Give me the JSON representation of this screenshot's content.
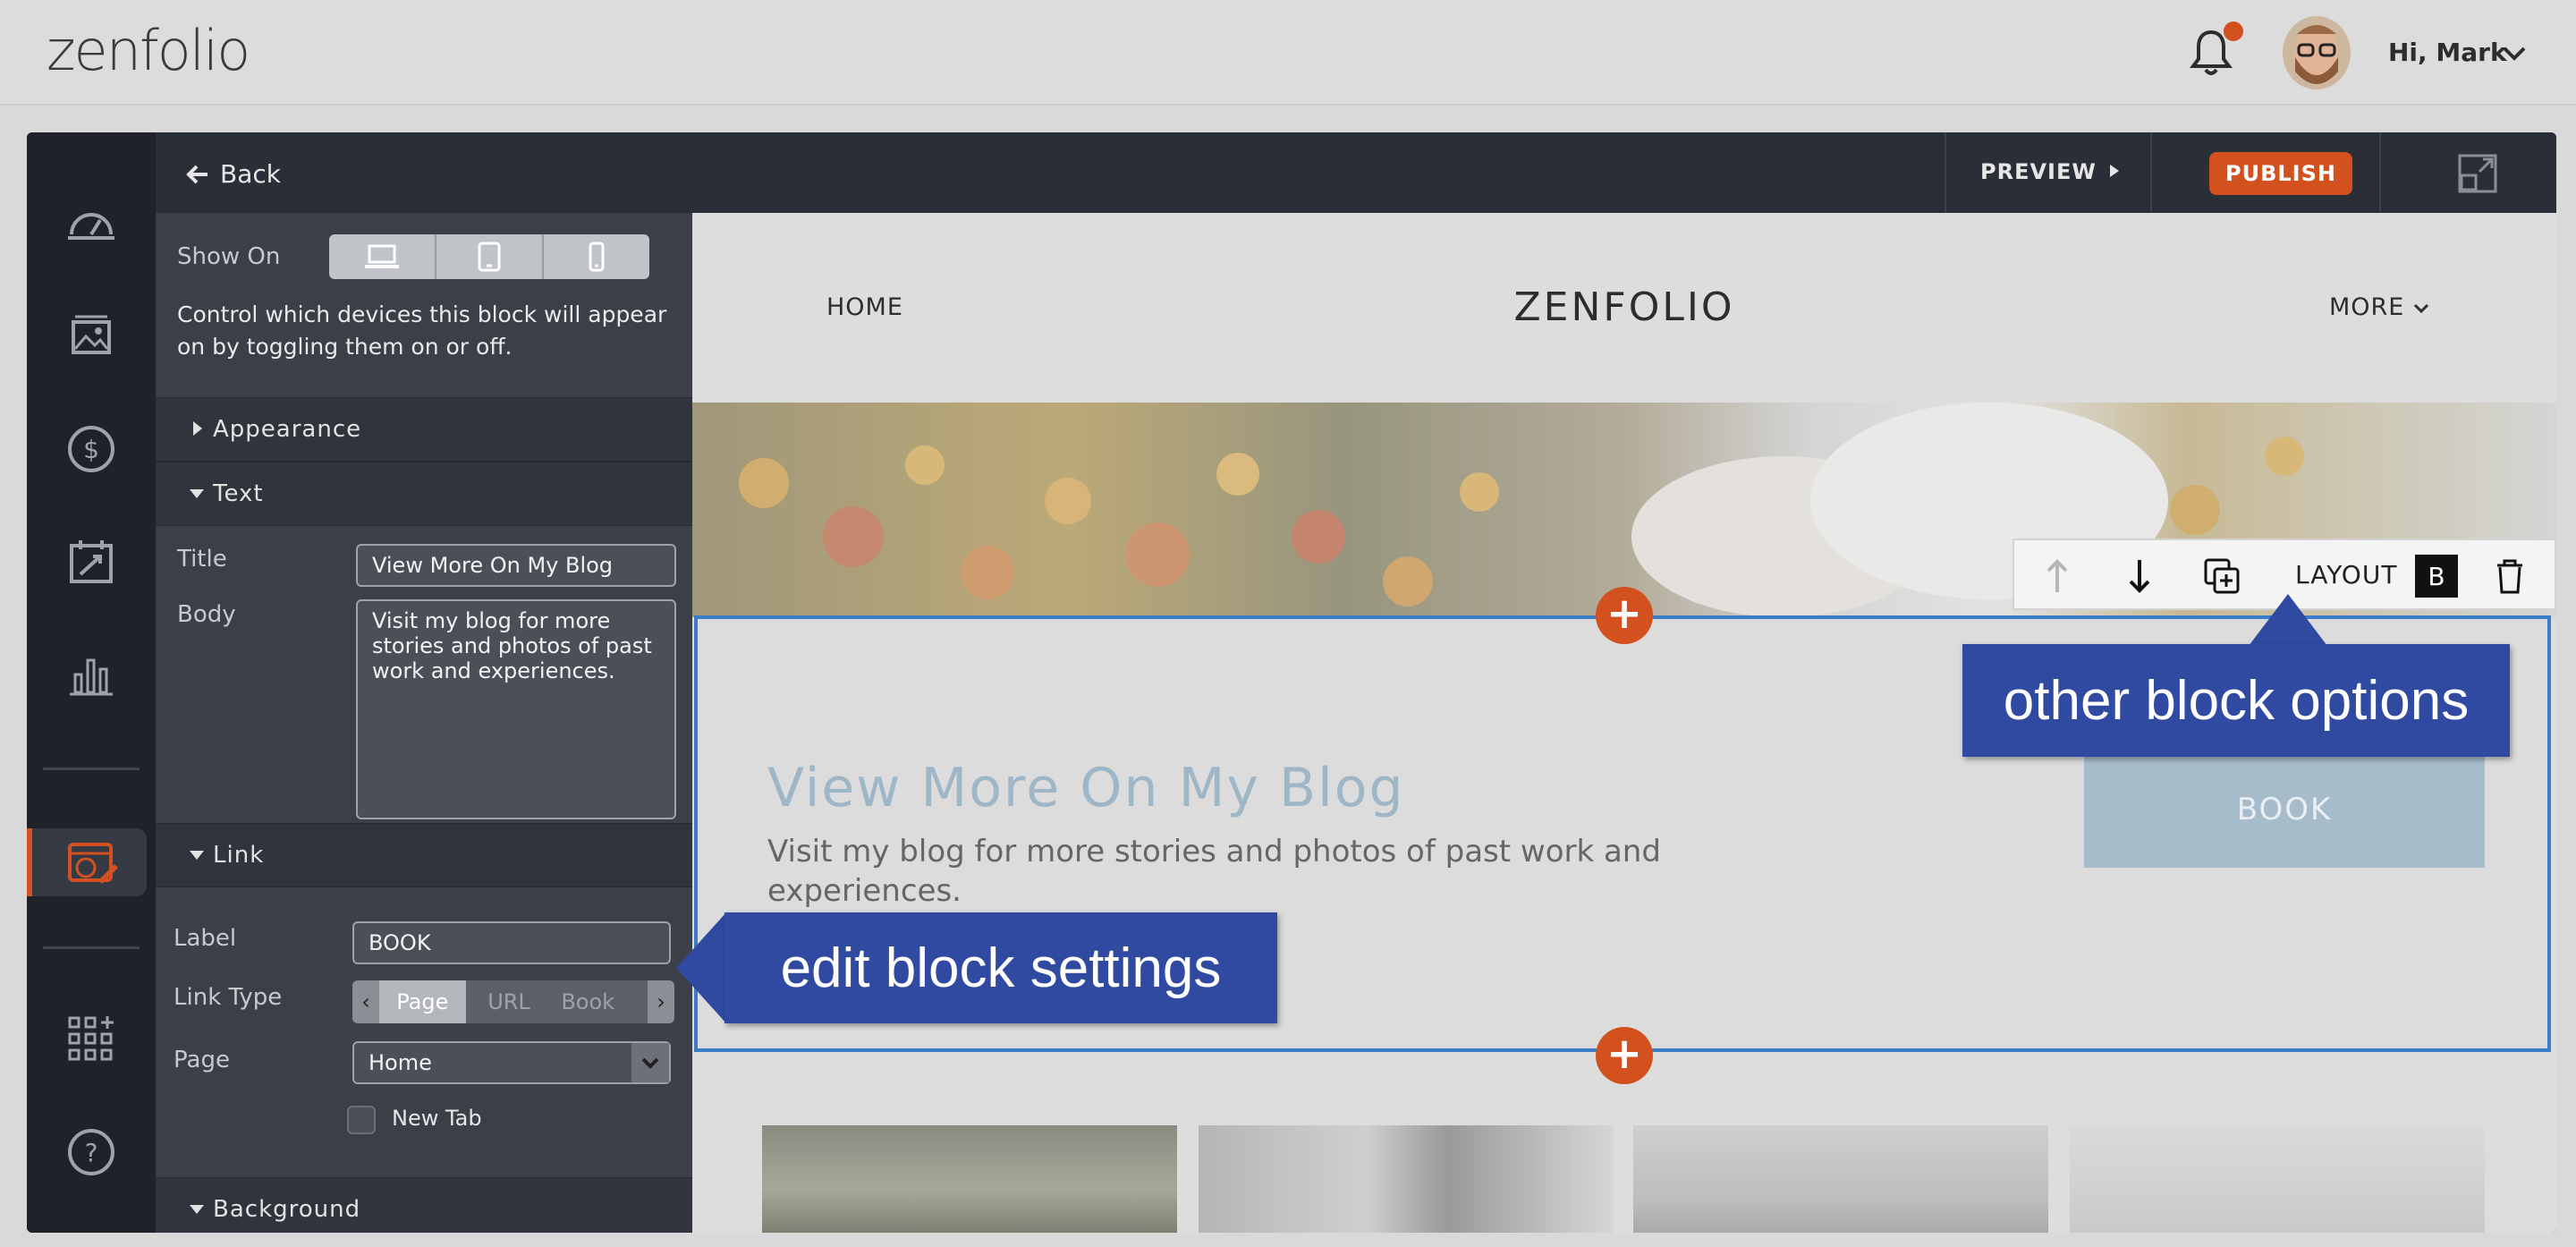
{
  "header": {
    "logo": "zenfolio",
    "greeting": "Hi, Mark"
  },
  "rail": {
    "icons": [
      "dashboard-icon",
      "photos-icon",
      "dollar-icon",
      "calendar-icon",
      "chart-icon",
      "website-icon",
      "apps-icon",
      "help-icon"
    ]
  },
  "panel": {
    "back": "Back",
    "show_on_label": "Show On",
    "show_on_desc": "Control which devices this block will appear on by toggling them on or off.",
    "sections": {
      "appearance": "Appearance",
      "text": "Text",
      "link": "Link",
      "background": "Background"
    },
    "title_label": "Title",
    "title_value": "View More On My Blog",
    "body_label": "Body",
    "body_value": "Visit my blog for more stories and photos of past work and experiences.",
    "label_label": "Label",
    "label_value": "BOOK",
    "linktype_label": "Link Type",
    "linktype_options": [
      "Page",
      "URL",
      "Book"
    ],
    "linktype_selected": "Page",
    "page_label": "Page",
    "page_value": "Home",
    "newtab_label": "New Tab"
  },
  "toolbar": {
    "preview": "PREVIEW",
    "publish": "PUBLISH"
  },
  "site": {
    "nav_home": "HOME",
    "brand": "ZENFOLIO",
    "nav_more": "MORE",
    "block_title": "View More On My Blog",
    "block_body": "Visit my blog for more stories and photos of past work and experiences.",
    "book_button": "BOOK",
    "layout_label": "LAYOUT",
    "layout_value": "B",
    "add_symbol": "+"
  },
  "annotations": {
    "edit_settings": "edit block settings",
    "other_options": "other block options"
  },
  "colors": {
    "accent": "#d2511e",
    "callout": "#2f4aa0",
    "selection": "#3d7cc9"
  }
}
